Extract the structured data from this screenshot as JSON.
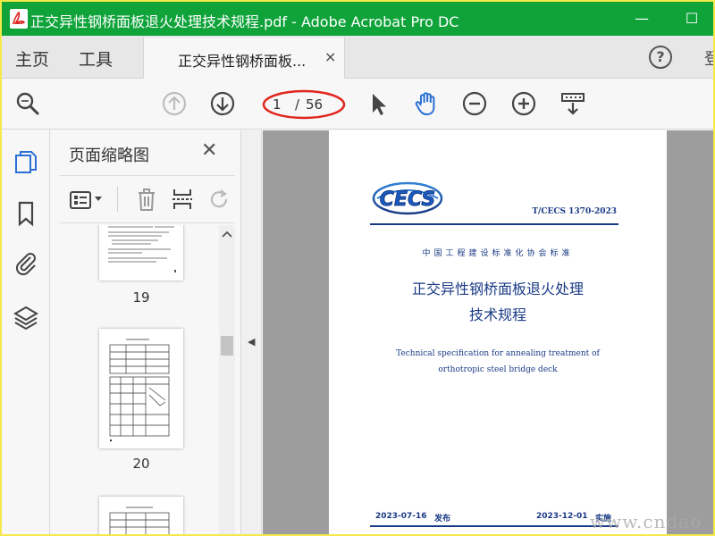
{
  "window": {
    "title": "正交异性钢桥面板退火处理技术规程.pdf - Adobe Acrobat Pro DC",
    "minimize_glyph": "—",
    "maximize_glyph": "☐"
  },
  "menu_tabs": {
    "home": "主页",
    "tools": "工具"
  },
  "doc_tab": {
    "label": "正交异性钢桥面板...",
    "close_glyph": "×"
  },
  "help_glyph": "?",
  "cutoff_glyph": "登",
  "toolbar": {
    "page_current": "1",
    "page_separator": "/",
    "page_total": "56",
    "icons": [
      "search-icon",
      "page-up-icon",
      "page-down-icon",
      "select-arrow-icon",
      "hand-tool-icon",
      "zoom-out-icon",
      "zoom-in-icon",
      "scroll-mode-icon"
    ]
  },
  "rail_icons": [
    "page-thumbnails-icon",
    "bookmark-icon",
    "attachment-icon",
    "layers-icon"
  ],
  "thumbnails": {
    "title": "页面缩略图",
    "close_glyph": "✕",
    "pages": [
      {
        "number": "19"
      },
      {
        "number": "20"
      }
    ]
  },
  "splitter_glyph": "◀",
  "document": {
    "logo_text": "CECS",
    "standard_no": "T/CECS 1370-2023",
    "association": "中国工程建设标准化协会标准",
    "title_cn_line1": "正交异性钢桥面板退火处理",
    "title_cn_line2": "技术规程",
    "title_en_line1": "Technical specification for annealing treatment of",
    "title_en_line2": "orthotropic steel bridge deck",
    "issue_date": "2023-07-16",
    "issue_label": "发布",
    "effective_date": "2023-12-01",
    "effective_label": "实施"
  },
  "watermark": "www.cndao",
  "colors": {
    "title_bar": "#0fa33a",
    "document_blue": "#1a3a86",
    "annotation_red": "#e0261d",
    "hand_tool_blue": "#2a6fd6"
  }
}
